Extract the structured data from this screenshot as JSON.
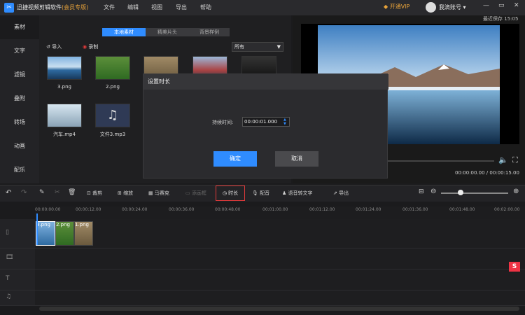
{
  "app": {
    "title": "迅捷视频剪辑软件",
    "member": "(会员专版)",
    "save_note_label": "最近保存",
    "save_time": "15:05"
  },
  "menu": [
    "文件",
    "编辑",
    "视图",
    "导出",
    "帮助"
  ],
  "header": {
    "vip": "开通VIP",
    "account": "我滴账号",
    "min": "—",
    "max": "▭",
    "close": "✕"
  },
  "sidebar": {
    "items": [
      {
        "label": "素材"
      },
      {
        "label": "文字"
      },
      {
        "label": "滤镜"
      },
      {
        "label": "叠附"
      },
      {
        "label": "转场"
      },
      {
        "label": "动画"
      },
      {
        "label": "配乐"
      }
    ]
  },
  "library": {
    "tabs": [
      {
        "label": "本地素材"
      },
      {
        "label": "精美片头"
      },
      {
        "label": "背景样例"
      }
    ],
    "import_label": "导入",
    "record_label": "录制",
    "filter_value": "所有",
    "items": [
      {
        "label": "3.png"
      },
      {
        "label": "2.png"
      },
      {
        "label": ""
      },
      {
        "label": ""
      },
      {
        "label": ""
      },
      {
        "label": "汽车.mp4"
      },
      {
        "label": "文件3.mp3"
      }
    ]
  },
  "preview": {
    "current": "00:00:00.00",
    "total": "00:00:15.00"
  },
  "dialog": {
    "title": "设置时长",
    "duration_label": "持续时间:",
    "duration_value": "00:00:01.000",
    "ok_label": "确定",
    "cancel_label": "取消"
  },
  "toolbar": {
    "crop": "裁剪",
    "zoom": "缩放",
    "mosaic": "马赛克",
    "add_pip": "添画框",
    "duration": "时长",
    "dub": "配音",
    "speech_to_text": "语音转文字",
    "export": "导出"
  },
  "ruler": [
    "00:00:00.00",
    "00:00:12.00",
    "00:00:24.00",
    "00:00:36.00",
    "00:00:48.00",
    "00:01:00.00",
    "00:01:12.00",
    "00:01:24.00",
    "00:01:36.00",
    "00:01:48.00",
    "00:02:00.00"
  ],
  "timeline": {
    "clips": [
      {
        "label": "3.png"
      },
      {
        "label": "2.png"
      },
      {
        "label": "1.png"
      }
    ]
  },
  "colors": {
    "accent": "#2f8cff",
    "highlight": "#e03a3a",
    "member": "#e8a33a"
  }
}
